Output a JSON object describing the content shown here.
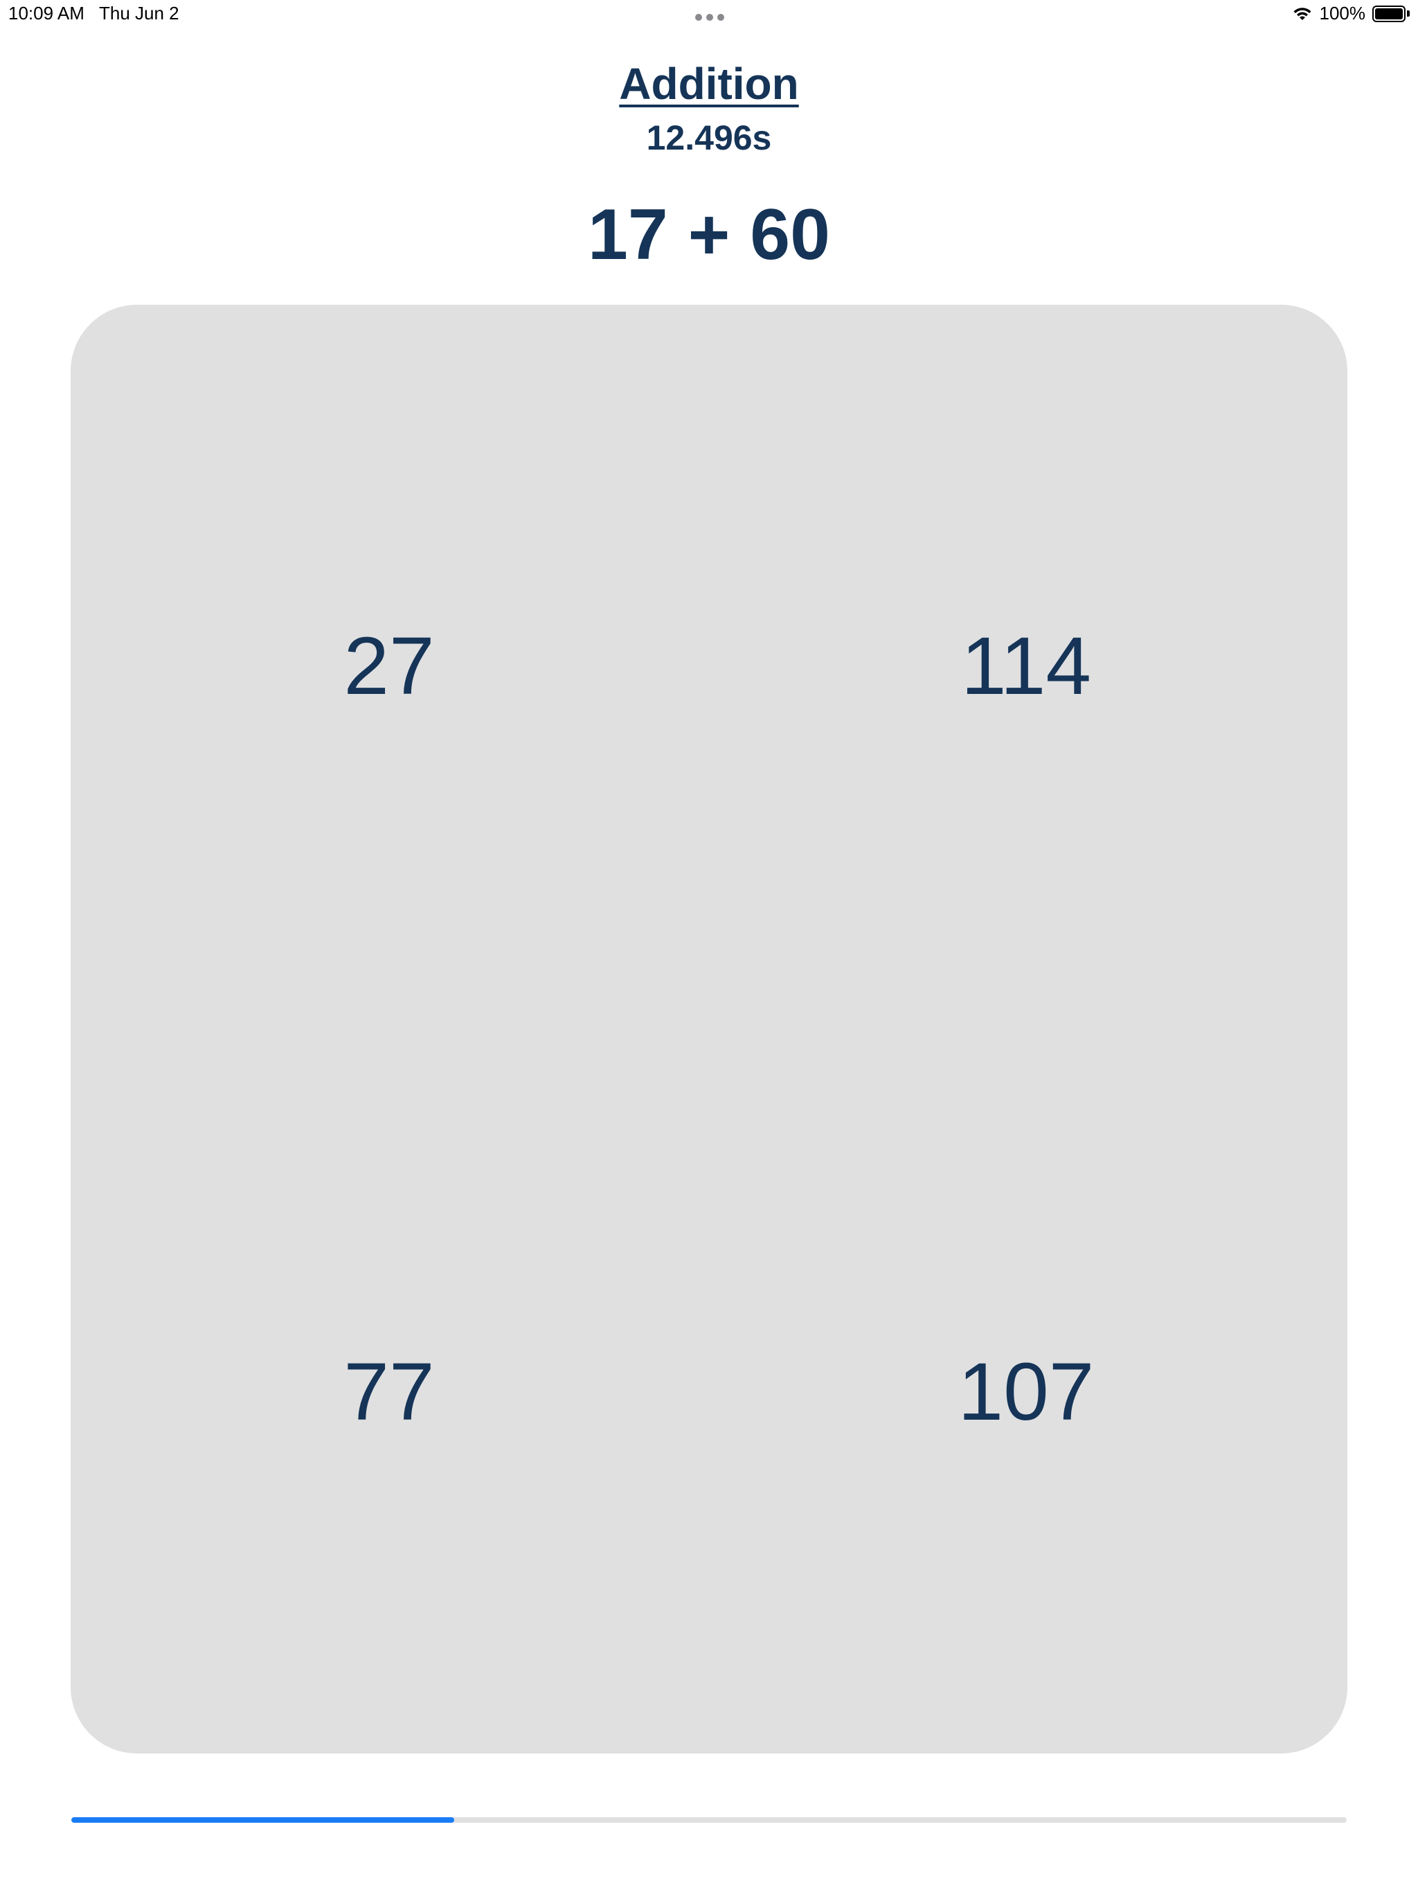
{
  "status_bar": {
    "time": "10:09 AM",
    "date": "Thu Jun 2",
    "battery_percent": "100%",
    "wifi_icon": "wifi-icon",
    "battery_icon": "battery-icon"
  },
  "quiz": {
    "title": "Addition",
    "timer": "12.496s",
    "question": "17 + 60",
    "answers": [
      "27",
      "114",
      "77",
      "107"
    ]
  },
  "progress": {
    "fraction": 0.3,
    "color": "#1a7cf5"
  },
  "colors": {
    "text": "#153457",
    "panel": "#e0e0e1",
    "accent": "#1a7cf5"
  }
}
